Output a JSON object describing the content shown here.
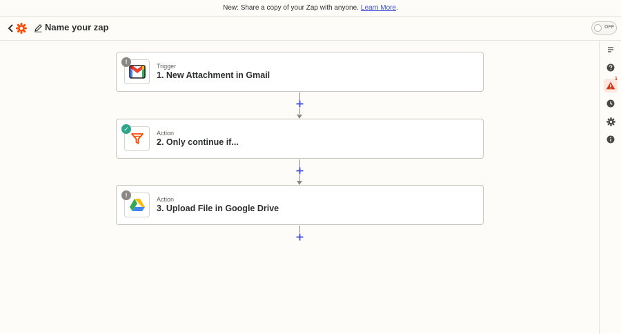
{
  "banner": {
    "text": "New: Share a copy of your Zap with anyone.",
    "link": "Learn More",
    "suffix": "."
  },
  "header": {
    "zap_name": "Name your zap",
    "toggle_label": "OFF"
  },
  "steps": [
    {
      "type": "Trigger",
      "title": "1. New Attachment in Gmail",
      "status": "alert",
      "status_symbol": "!",
      "app_icon": "gmail-icon"
    },
    {
      "type": "Action",
      "title": "2. Only continue if...",
      "status": "ok",
      "status_symbol": "✓",
      "app_icon": "filter-icon"
    },
    {
      "type": "Action",
      "title": "3. Upload File in Google Drive",
      "status": "alert",
      "status_symbol": "!",
      "app_icon": "google-drive-icon"
    }
  ],
  "rail": {
    "items": [
      "details-icon",
      "help-icon",
      "warning-icon",
      "history-icon",
      "settings-icon",
      "info-icon"
    ],
    "warning_count": "1"
  },
  "colors": {
    "accent": "#3d4ed8",
    "brand_orange": "#ff4a00",
    "ok": "#2fa58c",
    "warn": "#d13b1c"
  }
}
